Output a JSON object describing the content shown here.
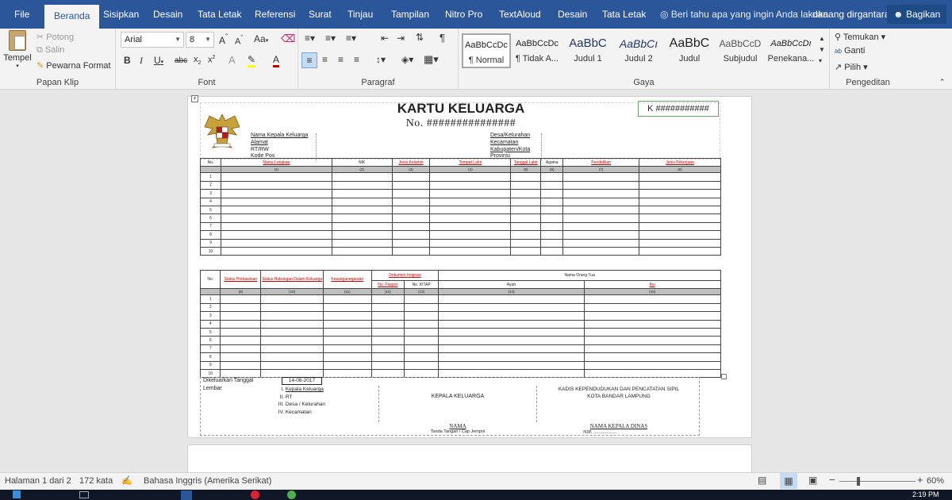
{
  "tabs": [
    "File",
    "Beranda",
    "Sisipkan",
    "Desain",
    "Tata Letak",
    "Referensi",
    "Surat",
    "Tinjau",
    "Tampilan",
    "Nitro Pro",
    "TextAloud",
    "Desain",
    "Tata Letak"
  ],
  "tell_me": "Beri tahu apa yang ingin Anda lakuka",
  "user": "danang dirgantara",
  "share": "Bagikan",
  "clipboard": {
    "paste": "Tempel",
    "cut": "Potong",
    "copy": "Salin",
    "format_painter": "Pewarna Format",
    "label": "Papan Klip"
  },
  "font": {
    "name": "Arial",
    "size": "8",
    "label": "Font"
  },
  "paragraph": {
    "label": "Paragraf"
  },
  "styles": {
    "label": "Gaya",
    "items": [
      {
        "preview": "AaBbCcDc",
        "name": "¶ Normal"
      },
      {
        "preview": "AaBbCcDc",
        "name": "¶ Tidak A..."
      },
      {
        "preview": "AaBbC",
        "name": "Judul 1"
      },
      {
        "preview": "AaBbCı",
        "name": "Judul 2"
      },
      {
        "preview": "AaBbC",
        "name": "Judul"
      },
      {
        "preview": "AaBbCcD",
        "name": "Subjudul"
      },
      {
        "preview": "AaBbCcDı",
        "name": "Penekana..."
      }
    ]
  },
  "editing": {
    "find": "Temukan",
    "replace": "Ganti",
    "select": "Pilih",
    "label": "Pengeditan"
  },
  "doc": {
    "title": "KARTU KELUARGA",
    "number": "No. ###############",
    "kbox": "K ###########",
    "left_fields": [
      "Nama Kepala Keluarga",
      "Alamat",
      "RT/RW",
      "Kode Pos"
    ],
    "right_fields": [
      "Desa/Kelurahan",
      "Kecamatan",
      "Kabupaten/Kota",
      "Provinsi"
    ],
    "t1_headers": [
      "No.",
      "Nama Lengkap",
      "NIK",
      "Jenis Kelamin",
      "Tempat Lahir",
      "Tanggal Lahir",
      "Agama",
      "Pendidikan",
      "Jenis Pekerjaan"
    ],
    "t1_numbers": [
      "(1)",
      "(2)",
      "(3)",
      "(4)",
      "(5)",
      "(6)",
      "(7)",
      "(8)"
    ],
    "t2_headers": [
      "No.",
      "Status Perkawinan",
      "Status Hubungan Dalam Keluarga",
      "Kewarganegaraan",
      "Dokumen Imigrasi",
      "Nama Orang Tua"
    ],
    "t2_sub": [
      "No. Paspor",
      "No. KITAP",
      "Ayah",
      "Ibu"
    ],
    "t2_numbers": [
      "(9)",
      "(10)",
      "(11)",
      "(12)",
      "(13)",
      "(14)",
      "(15)"
    ],
    "rows": [
      "1",
      "2",
      "3",
      "4",
      "5",
      "6",
      "7",
      "8",
      "9",
      "10"
    ],
    "issued_label": "Dikeluarkan Tanggal",
    "issued_date": "14-08-2017",
    "sheet_label": "Lembar",
    "sheets": [
      {
        "n": "I.",
        "t": "Kepala Keluarga"
      },
      {
        "n": "II.",
        "t": "RT"
      },
      {
        "n": "III.",
        "t": "Desa / Kelurahan"
      },
      {
        "n": "IV.",
        "t": "Kecamatan"
      }
    ],
    "kepala": "KEPALA KELUARGA",
    "kadis1": "KADIS KEPENDUDUKAN DAN PENCATATAN SIPIL",
    "kadis2": "KOTA BANDAR LAMPUNG",
    "nama": "NAMA",
    "ttd": "Tanda Tangan / Cap Jempol",
    "nama_kadis": "NAMA KEPALA DINAS",
    "nip": "NIP. .................."
  },
  "status": {
    "page": "Halaman 1 dari 2",
    "words": "172 kata",
    "lang": "Bahasa Inggris (Amerika Serikat)",
    "zoom": "60%"
  },
  "clock": "2:19 PM"
}
